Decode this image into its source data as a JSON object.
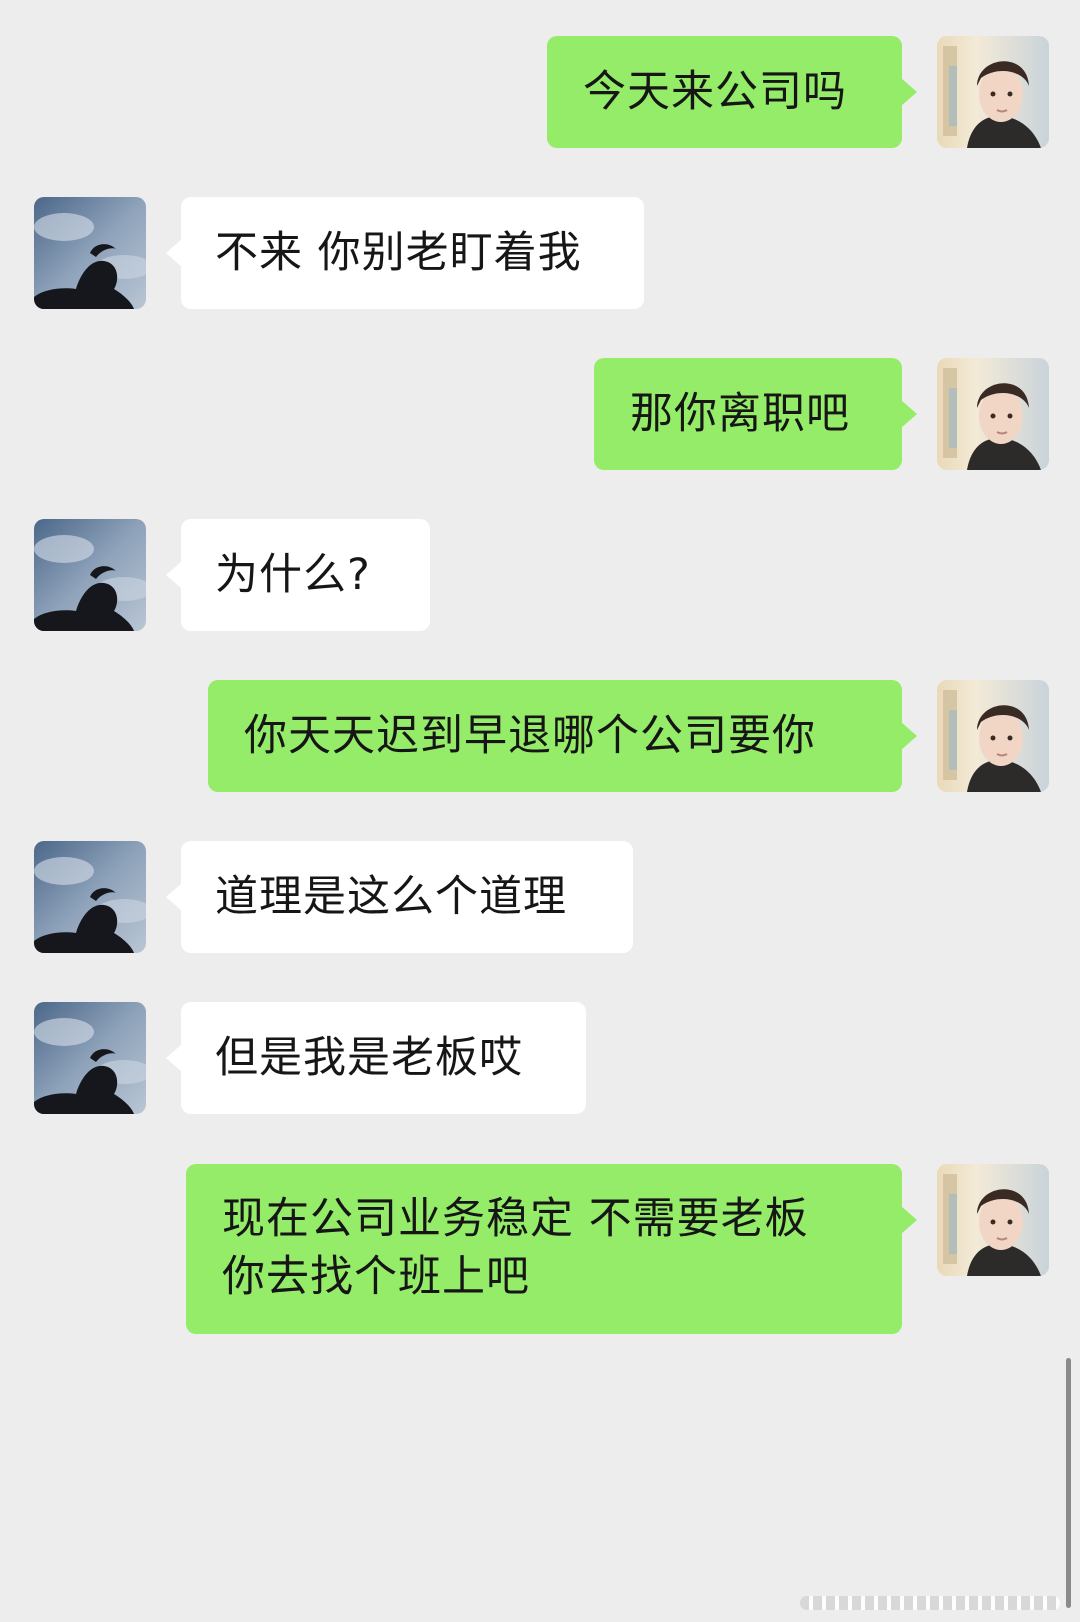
{
  "colors": {
    "background": "#ededed",
    "outgoing_bubble": "#95ec69",
    "incoming_bubble": "#ffffff",
    "text": "#161616"
  },
  "avatars": {
    "me": "young-man-portrait-photo",
    "other": "silhouette-against-sky-photo"
  },
  "messages": [
    {
      "sender": "me",
      "text": "今天来公司吗"
    },
    {
      "sender": "other",
      "text": "不来 你别老盯着我"
    },
    {
      "sender": "me",
      "text": "那你离职吧"
    },
    {
      "sender": "other",
      "text": "为什么?"
    },
    {
      "sender": "me",
      "text": "你天天迟到早退哪个公司要你"
    },
    {
      "sender": "other",
      "text": "道理是这么个道理"
    },
    {
      "sender": "other",
      "text": "但是我是老板哎"
    },
    {
      "sender": "me",
      "text": "现在公司业务稳定 不需要老板\n你去找个班上吧"
    }
  ]
}
